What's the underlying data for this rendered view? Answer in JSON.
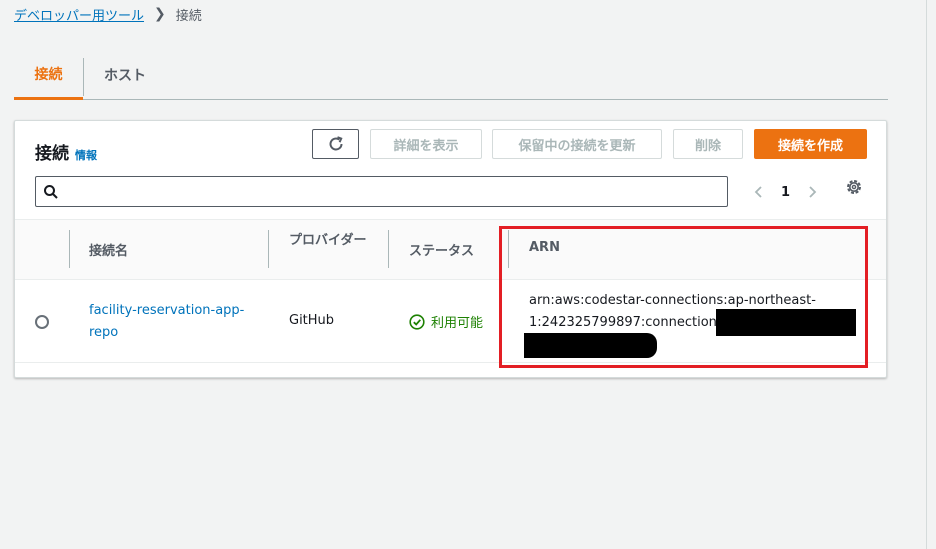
{
  "breadcrumb": {
    "parent": "デベロッパー用ツール",
    "current": "接続"
  },
  "tabs": [
    {
      "label": "接続",
      "active": true
    },
    {
      "label": "ホスト",
      "active": false
    }
  ],
  "panel": {
    "title": "接続",
    "info_label": "情報",
    "buttons": {
      "refresh_icon": "refresh-icon",
      "details": "詳細を表示",
      "update_pending": "保留中の接続を更新",
      "delete": "削除",
      "create": "接続を作成"
    },
    "search": {
      "placeholder": "",
      "value": ""
    },
    "pagination": {
      "current_page": "1"
    }
  },
  "table": {
    "columns": {
      "name": "接続名",
      "provider": "プロバイダー",
      "status": "ステータス",
      "arn": "ARN"
    },
    "rows": [
      {
        "name": "facility-reservation-app-repo",
        "provider": "GitHub",
        "status": "利用可能",
        "arn": "arn:aws:codestar-connections:ap-northeast-1:242325799897:connection/"
      }
    ]
  },
  "colors": {
    "accent": "#ec7211",
    "link": "#0073bb",
    "success": "#1d8102",
    "highlight": "#e31e24"
  }
}
